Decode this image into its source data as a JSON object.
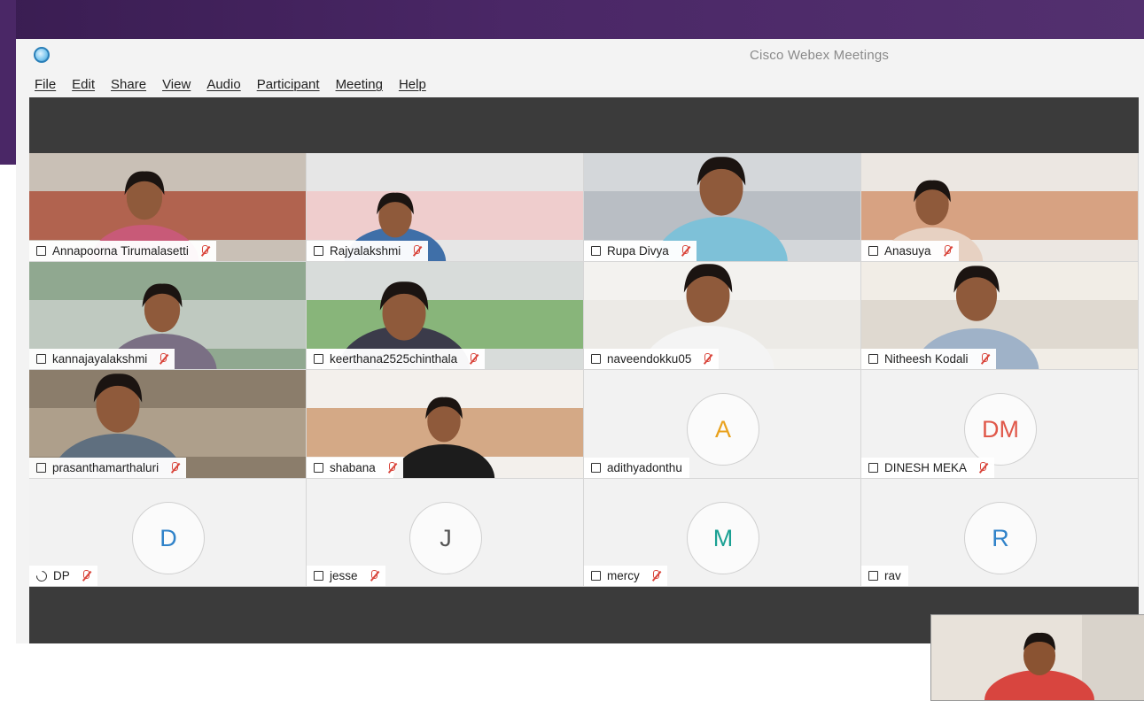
{
  "window": {
    "title": "Cisco Webex Meetings"
  },
  "menu": [
    {
      "label": "File"
    },
    {
      "label": "Edit"
    },
    {
      "label": "Share"
    },
    {
      "label": "View"
    },
    {
      "label": "Audio"
    },
    {
      "label": "Participant"
    },
    {
      "label": "Meeting"
    },
    {
      "label": "Help"
    }
  ],
  "participants": [
    {
      "name": "Annapoorna Tirumalasetti",
      "muted": true,
      "video": true
    },
    {
      "name": "Rajyalakshmi",
      "muted": true,
      "video": true
    },
    {
      "name": "Rupa Divya",
      "muted": true,
      "video": true
    },
    {
      "name": "Anasuya",
      "muted": true,
      "video": true
    },
    {
      "name": "kannajayalakshmi",
      "muted": true,
      "video": true
    },
    {
      "name": "keerthana2525chinthala",
      "muted": true,
      "video": true
    },
    {
      "name": "naveendokku05",
      "muted": true,
      "video": true
    },
    {
      "name": "Nitheesh Kodali",
      "muted": true,
      "video": true
    },
    {
      "name": "prasanthamarthaluri",
      "muted": true,
      "video": true
    },
    {
      "name": "shabana",
      "muted": true,
      "video": true
    },
    {
      "name": "adithyadonthu",
      "muted": false,
      "video": false,
      "initials": "A",
      "avatar_color": "#e9a11c"
    },
    {
      "name": "DINESH MEKA",
      "muted": true,
      "video": false,
      "initials": "DM",
      "avatar_color": "#e0584a"
    },
    {
      "name": "DP",
      "muted": true,
      "video": false,
      "initials": "D",
      "avatar_color": "#2f82c9",
      "audio_only": true
    },
    {
      "name": "jesse",
      "muted": true,
      "video": false,
      "initials": "J",
      "avatar_color": "#555555"
    },
    {
      "name": "mercy",
      "muted": true,
      "video": false,
      "initials": "M",
      "avatar_color": "#1aa093"
    },
    {
      "name": "rav",
      "muted": false,
      "video": false,
      "initials": "R",
      "avatar_color": "#2f82c9"
    }
  ],
  "colors": {
    "mute": "#d9463c",
    "stage": "#3b3b3b",
    "titlebar_text": "#8a8a8a"
  }
}
